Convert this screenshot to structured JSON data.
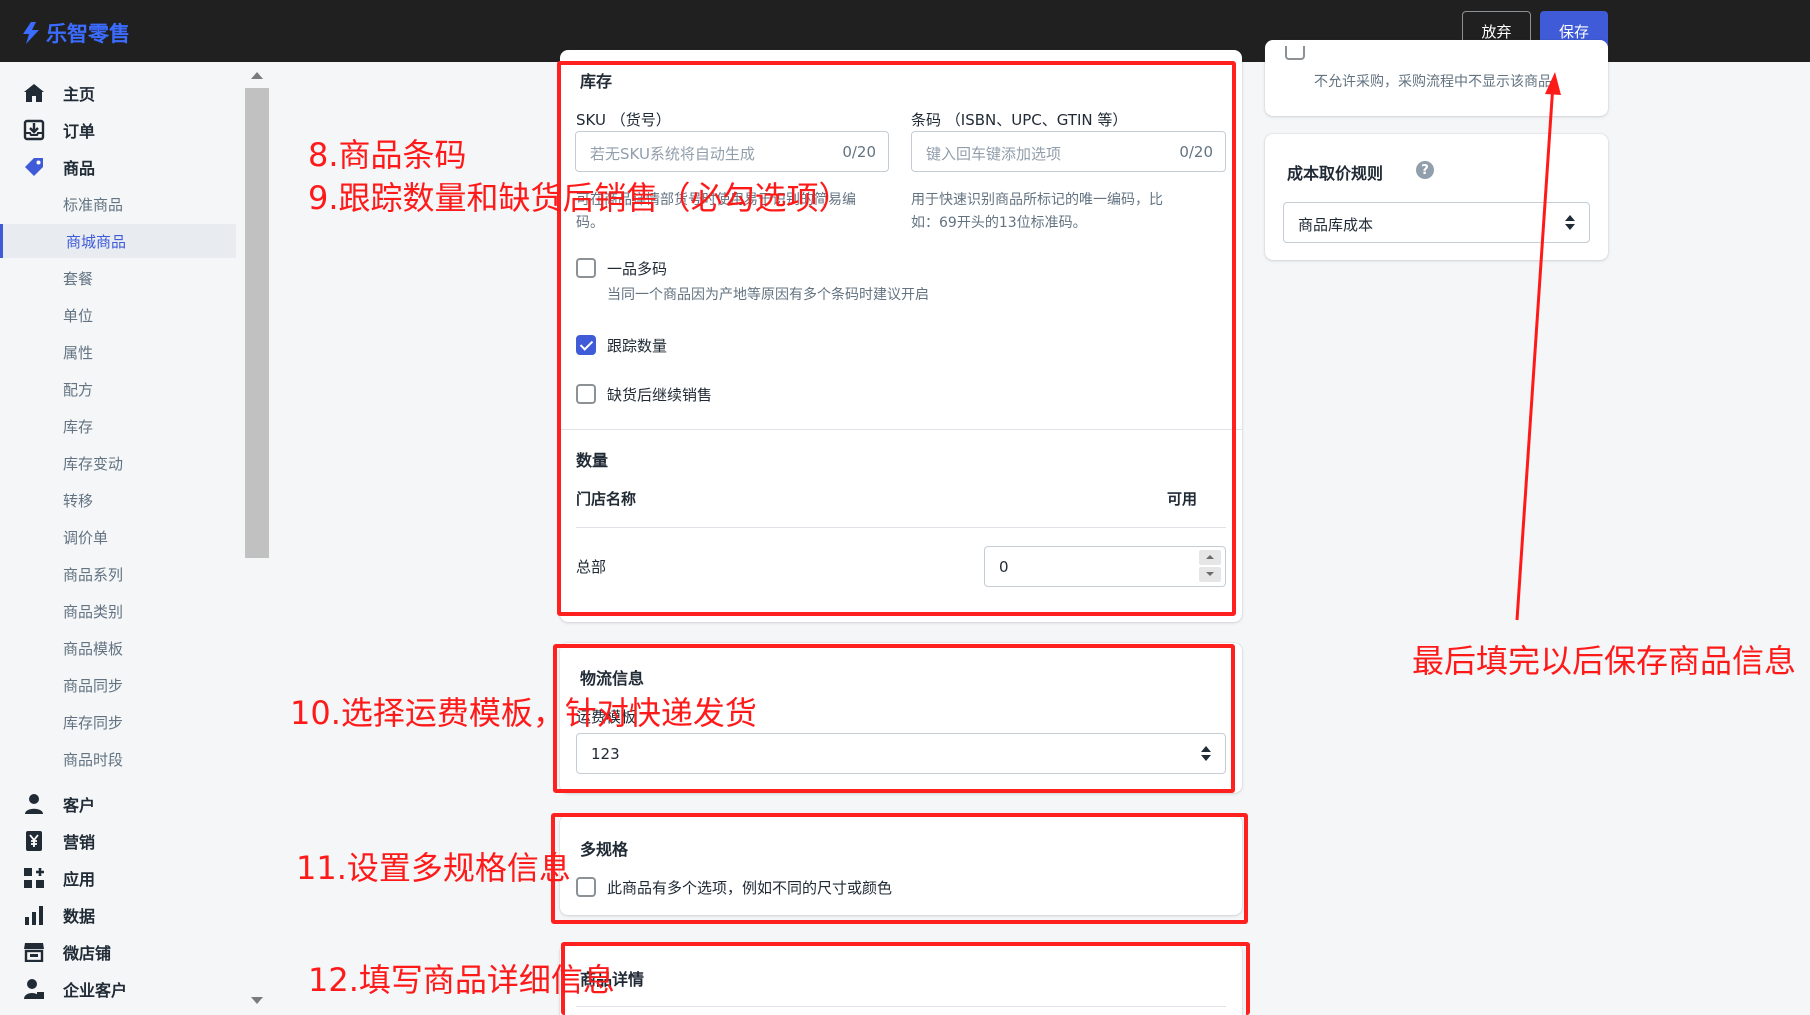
{
  "app": {
    "brand": "乐智零售"
  },
  "toolbar": {
    "discard_label": "放弃",
    "save_label": "保存"
  },
  "sidebar": {
    "items": [
      {
        "label": "主页",
        "icon": "home-icon"
      },
      {
        "label": "订单",
        "icon": "inbox-download-icon"
      },
      {
        "label": "商品",
        "icon": "tag-icon"
      }
    ],
    "sub_items": [
      "标准商品",
      "商城商品",
      "套餐",
      "单位",
      "属性",
      "配方",
      "库存",
      "库存变动",
      "转移",
      "调价单",
      "商品系列",
      "商品类别",
      "商品模板",
      "商品同步",
      "库存同步",
      "商品时段"
    ],
    "active_sub_item": "商城商品",
    "bottom_items": [
      {
        "label": "客户",
        "icon": "person-icon"
      },
      {
        "label": "营销",
        "icon": "yen-icon"
      },
      {
        "label": "应用",
        "icon": "apps-icon"
      },
      {
        "label": "数据",
        "icon": "bar-chart-icon"
      },
      {
        "label": "微店铺",
        "icon": "store-icon"
      },
      {
        "label": "企业客户",
        "icon": "business-user-icon"
      }
    ]
  },
  "inventory": {
    "title": "库存",
    "sku_label": "SKU （货号）",
    "sku_placeholder": "若无SKU系统将自动生成",
    "sku_counter": "0/20",
    "sku_help": "可在商品详情部货号时使用易于识别的简易编码。",
    "barcode_label": "条码 （ISBN、UPC、GTIN 等）",
    "barcode_placeholder": "键入回车键添加选项",
    "barcode_counter": "0/20",
    "barcode_help_1": "用于快速识别商品所标记的唯一编码，比",
    "barcode_help_2": "如：69开头的13位标准码。",
    "multi_code_label": "一品多码",
    "multi_code_checked": false,
    "multi_code_help": "当同一个商品因为产地等原因有多个条码时建议开启",
    "track_qty_label": "跟踪数量",
    "track_qty_checked": true,
    "continue_sell_label": "缺货后继续销售",
    "continue_sell_checked": false
  },
  "quantity": {
    "title": "数量",
    "col_store": "门店名称",
    "col_available": "可用",
    "rows": [
      {
        "store": "总部",
        "available": "0"
      }
    ]
  },
  "shipping": {
    "title": "物流信息",
    "template_label": "运费模板",
    "template_value": "123"
  },
  "variants": {
    "title": "多规格",
    "option_label": "此商品有多个选项，例如不同的尺寸或颜色",
    "checked": false
  },
  "details": {
    "title": "商品详情"
  },
  "purchase": {
    "help": "不允许采购，采购流程中不显示该商品"
  },
  "cost_rule": {
    "title": "成本取价规则",
    "value": "商品库成本"
  },
  "annotations": {
    "a1_line1": "8.商品条码",
    "a1_line2": "9.跟踪数量和缺货后销售（必勾选项）",
    "a2": "10.选择运费模板，针对快递发货",
    "a3": "11.设置多规格信息",
    "a4": "12.填写商品详细信息",
    "a5": "最后填完以后保存商品信息",
    "color": "#ff1a1a"
  }
}
